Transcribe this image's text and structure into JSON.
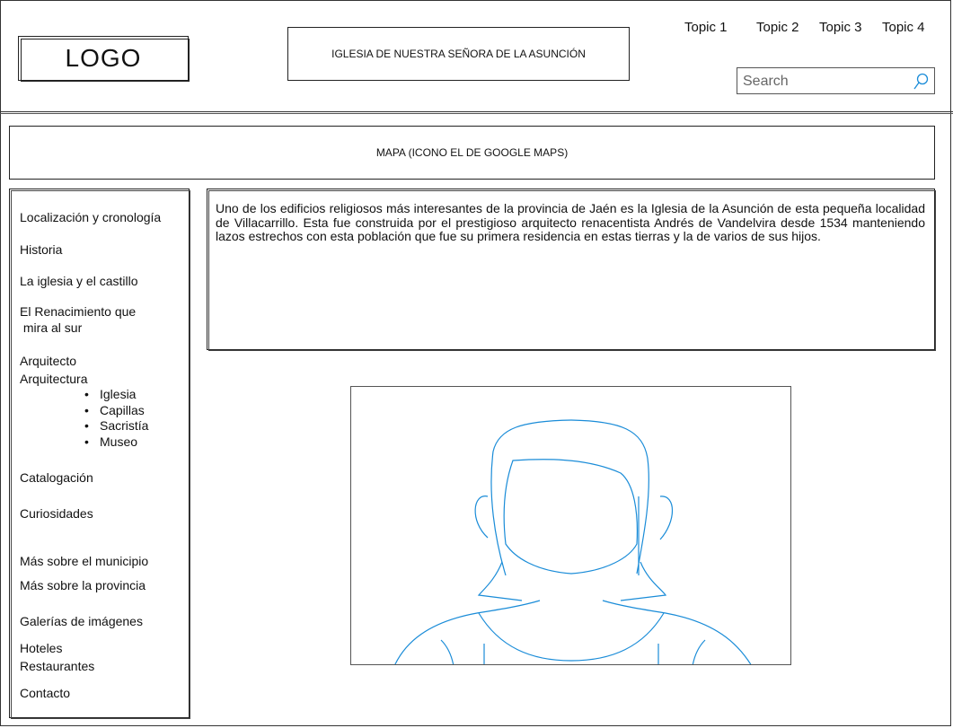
{
  "header": {
    "logo": "LOGO",
    "title": "IGLESIA DE NUESTRA SEÑORA DE LA ASUNCIÓN",
    "nav": [
      "Topic 1",
      "Topic 2",
      "Topic 3",
      "Topic 4"
    ],
    "search_placeholder": "Search",
    "search_icon": "search-icon"
  },
  "map": {
    "label": "MAPA  (ICONO EL DE GOOGLE MAPS)"
  },
  "sidebar": {
    "items": [
      "Localización y cronología",
      "Historia",
      "La iglesia y el castillo",
      "El Renacimiento que",
      " mira al sur",
      "Arquitecto",
      "Arquitectura",
      "Catalogación",
      "Curiosidades",
      "Más sobre el municipio",
      "Más sobre la provincia",
      "Galerías de imágenes",
      "Hoteles",
      "Restaurantes",
      "Contacto"
    ],
    "sub_items": [
      "Iglesia",
      "Capillas",
      "Sacristía",
      "Museo"
    ]
  },
  "content": {
    "paragraph": "Uno de los edificios religiosos más interesantes de la provincia de Jaén es la Iglesia de la Asunción de esta pequeña localidad  de Villacarrillo. Esta fue construida por el prestigioso arquitecto renacentista Andrés de Vandelvira desde 1534 manteniendo lazos estrechos con esta población que fue su primera residencia en estas tierras y la de varios de sus hijos."
  },
  "image": {
    "icon": "person-placeholder-icon",
    "accent_color": "#1a8cd8"
  }
}
